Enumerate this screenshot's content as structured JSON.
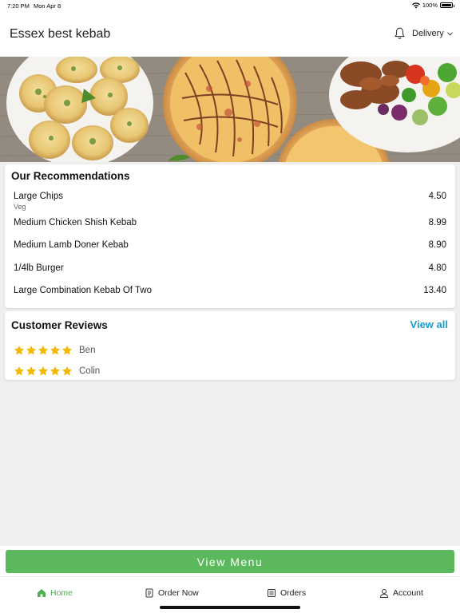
{
  "status_bar": {
    "time": "7:20 PM",
    "date": "Mon Apr 8",
    "battery": "100%",
    "battery_level": 1.0
  },
  "header": {
    "store_name": "Essex best kebab",
    "delivery_label": "Delivery"
  },
  "colors": {
    "accent_green": "#5cb85c",
    "link_blue": "#1a9bd0",
    "star_gold": "#f5b800"
  },
  "recommendations": {
    "title": "Our Recommendations",
    "items": [
      {
        "name": "Large Chips",
        "tag": "Veg",
        "price": "4.50"
      },
      {
        "name": "Medium Chicken Shish Kebab",
        "price": "8.99"
      },
      {
        "name": "Medium Lamb Doner Kebab",
        "price": "8.90"
      },
      {
        "name": "1/4lb Burger",
        "price": "4.80"
      },
      {
        "name": "Large Combination Kebab Of Two",
        "price": "13.40"
      }
    ]
  },
  "reviews": {
    "title": "Customer Reviews",
    "view_all": "View all",
    "items": [
      {
        "name": "Ben",
        "rating": 5
      },
      {
        "name": "Colin",
        "rating": 5
      }
    ]
  },
  "view_menu_label": "View Menu",
  "tabs": [
    {
      "label": "Home",
      "icon": "home-icon",
      "active": true
    },
    {
      "label": "Order Now",
      "icon": "order-icon",
      "active": false
    },
    {
      "label": "Orders",
      "icon": "receipt-icon",
      "active": false
    },
    {
      "label": "Account",
      "icon": "user-icon",
      "active": false
    }
  ]
}
